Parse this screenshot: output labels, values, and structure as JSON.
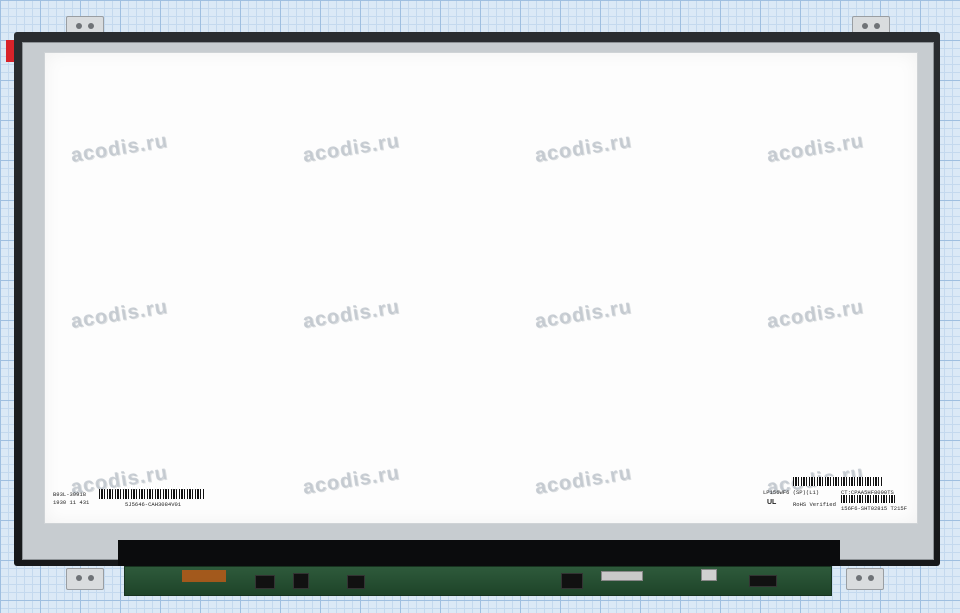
{
  "watermark": {
    "text": "acodis.ru",
    "rows": [
      [
        "acodis.ru",
        "acodis.ru",
        "acodis.ru",
        "acodis.ru"
      ],
      [
        "acodis.ru",
        "acodis.ru",
        "acodis.ru",
        "acodis.ru"
      ],
      [
        "acodis.ru",
        "acodis.ru",
        "acodis.ru",
        "acodis.ru"
      ]
    ]
  },
  "labels": {
    "left_code": "B93L-30918",
    "left_sub": "1930 11  431",
    "left_serial": "5J5646-CAH3084V01",
    "right_model": "LP156WF6 (SP)(L1)",
    "right_ct": "CT:CPAA5HF8090TS",
    "right_rohs": "RoHS Verified",
    "right_bottom": "156F6-SHT02815  T215F",
    "ul_mark": "UL"
  },
  "colors": {
    "frame": "#1e2022",
    "bezel": "#c7ccd0",
    "screen": "#fdfdfd",
    "pcb": "#2e5a3b",
    "grid": "#9fbfe0"
  }
}
